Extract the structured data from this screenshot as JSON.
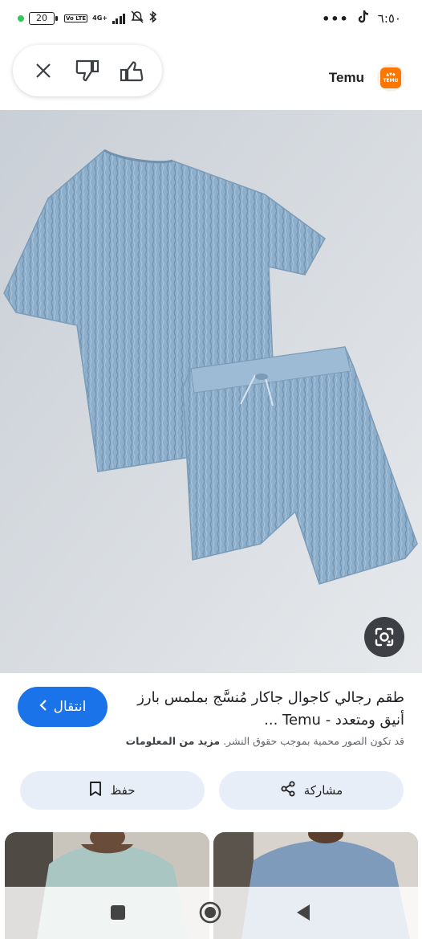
{
  "status_bar": {
    "battery": "20",
    "network_type": "4G+",
    "volte_label": "Vo LTE",
    "time": "٦:٥٠",
    "more_dots": "•••"
  },
  "feedback": {
    "close_icon": "close-icon",
    "dislike_icon": "thumbs-down-icon",
    "like_icon": "thumbs-up-icon"
  },
  "source": {
    "name": "Temu",
    "logo_text": "TEMU",
    "brand_color": "#fb7701"
  },
  "result": {
    "title": "طقم رجالي كاجوال جاكار مُنسَّج بملمس بارز أنيق ومتعدد - Temu ...",
    "visit_label": "انتقال",
    "copyright_text": "قد تكون الصور محمية بموجب حقوق النشر.",
    "more_info_label": "مزيد من المعلومات"
  },
  "actions": {
    "share_label": "مشاركة",
    "save_label": "حفظ"
  },
  "colors": {
    "accent": "#1a73e8",
    "chip_bg": "#e8eef8",
    "product_blue": "#8fb0cc"
  }
}
